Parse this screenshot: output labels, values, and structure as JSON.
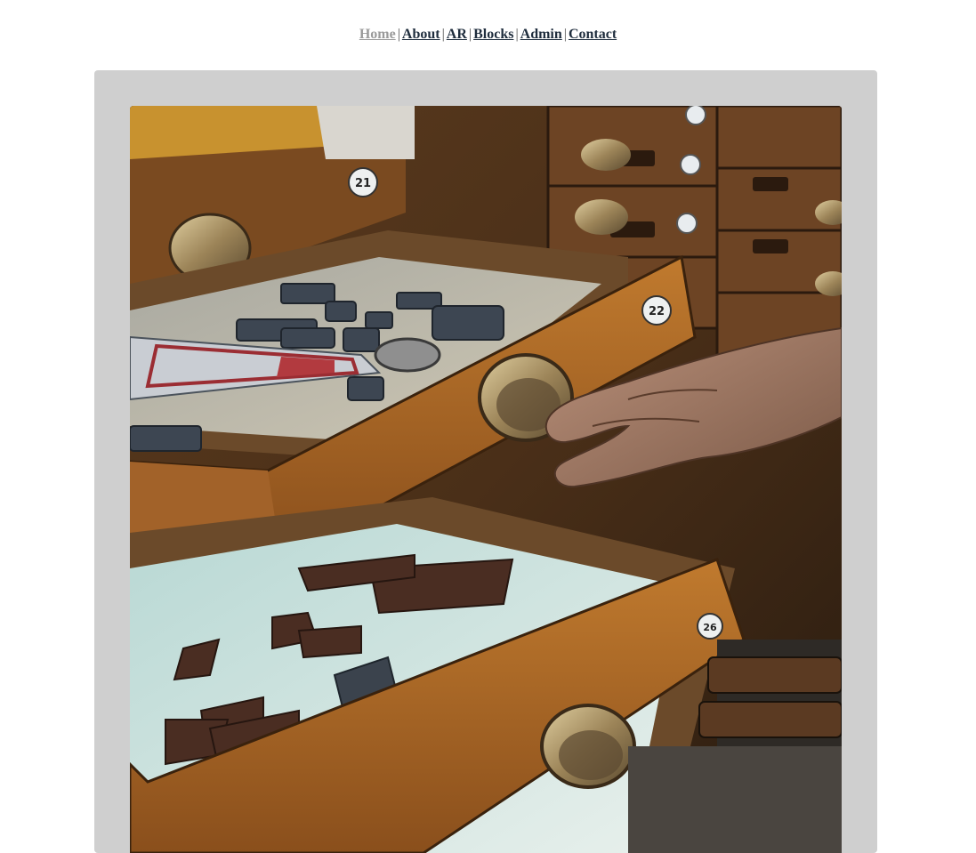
{
  "nav": {
    "items": [
      {
        "label": "Home",
        "current": true
      },
      {
        "label": "About",
        "current": false
      },
      {
        "label": "AR",
        "current": false
      },
      {
        "label": "Blocks",
        "current": false
      },
      {
        "label": "Admin",
        "current": false
      },
      {
        "label": "Contact",
        "current": false
      }
    ],
    "separator": "|"
  },
  "photo": {
    "drawer_numbers": [
      "21",
      "22",
      "26"
    ]
  },
  "colors": {
    "nav_current": "#9a9a9a",
    "nav_link": "#1f2d3d",
    "card_background": "#cfcfcf"
  }
}
